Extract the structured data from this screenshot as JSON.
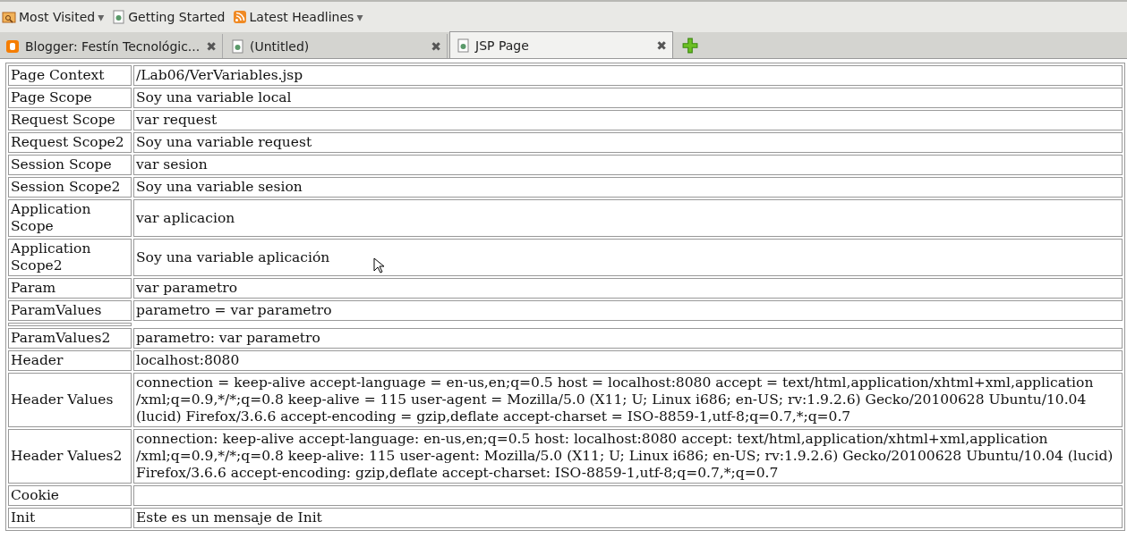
{
  "bookmarks": [
    {
      "label": "Most Visited",
      "kind": "folder",
      "dropdown": "▾"
    },
    {
      "label": "Getting Started",
      "kind": "page"
    },
    {
      "label": "Latest Headlines",
      "kind": "feed",
      "dropdown": "▾"
    }
  ],
  "tabs": [
    {
      "title": "Blogger: Festín Tecnológic...",
      "kind": "blog",
      "selected": false,
      "close": "✖"
    },
    {
      "title": "(Untitled)",
      "kind": "page",
      "selected": false,
      "close": "✖"
    },
    {
      "title": "JSP Page",
      "kind": "page",
      "selected": true,
      "close": "✖"
    }
  ],
  "table": {
    "rows": [
      {
        "kind": "data",
        "label": "Page Context",
        "value": [
          "/Lab06/VerVariables.jsp"
        ]
      },
      {
        "kind": "data",
        "label": "Page Scope",
        "value": [
          "Soy una variable local"
        ]
      },
      {
        "kind": "data",
        "label": "Request Scope",
        "value": [
          "var request"
        ]
      },
      {
        "kind": "data",
        "label": "Request Scope2",
        "value": [
          "Soy una variable request"
        ]
      },
      {
        "kind": "data",
        "label": "Session Scope",
        "value": [
          "var sesion"
        ]
      },
      {
        "kind": "data",
        "label": "Session Scope2",
        "value": [
          "Soy una variable sesion"
        ]
      },
      {
        "kind": "data",
        "label": "Application Scope",
        "value": [
          "var aplicacion"
        ]
      },
      {
        "kind": "data",
        "label": "Application Scope2",
        "value": [
          "Soy una variable aplicación"
        ]
      },
      {
        "kind": "data",
        "label": "Param",
        "value": [
          "var parametro"
        ]
      },
      {
        "kind": "data",
        "label": "ParamValues",
        "value": [
          "parametro = var parametro"
        ]
      },
      {
        "kind": "blank"
      },
      {
        "kind": "data",
        "label": "ParamValues2",
        "value": [
          "parametro: var parametro"
        ]
      },
      {
        "kind": "data",
        "label": "Header",
        "value": [
          "localhost:8080"
        ]
      },
      {
        "kind": "data",
        "label": "Header Values",
        "value": [
          "connection = keep-alive accept-language = en-us,en;q=0.5 host = localhost:8080 accept = text/html,application/xhtml+xml,application",
          "/xml;q=0.9,*/*;q=0.8 keep-alive = 115 user-agent = Mozilla/5.0 (X11; U; Linux i686; en-US; rv:1.9.2.6) Gecko/20100628 Ubuntu/10.04",
          "(lucid) Firefox/3.6.6 accept-encoding = gzip,deflate accept-charset = ISO-8859-1,utf-8;q=0.7,*;q=0.7"
        ]
      },
      {
        "kind": "data",
        "label": "Header Values2",
        "value": [
          "connection: keep-alive accept-language: en-us,en;q=0.5 host: localhost:8080 accept: text/html,application/xhtml+xml,application",
          "/xml;q=0.9,*/*;q=0.8 keep-alive: 115 user-agent: Mozilla/5.0 (X11; U; Linux i686; en-US; rv:1.9.2.6) Gecko/20100628 Ubuntu/10.04 (lucid)",
          "Firefox/3.6.6 accept-encoding: gzip,deflate accept-charset: ISO-8859-1,utf-8;q=0.7,*;q=0.7"
        ]
      },
      {
        "kind": "data",
        "label": "Cookie",
        "value": []
      },
      {
        "kind": "data",
        "label": "Init",
        "value": [
          "Este es un mensaje de Init"
        ]
      }
    ]
  }
}
